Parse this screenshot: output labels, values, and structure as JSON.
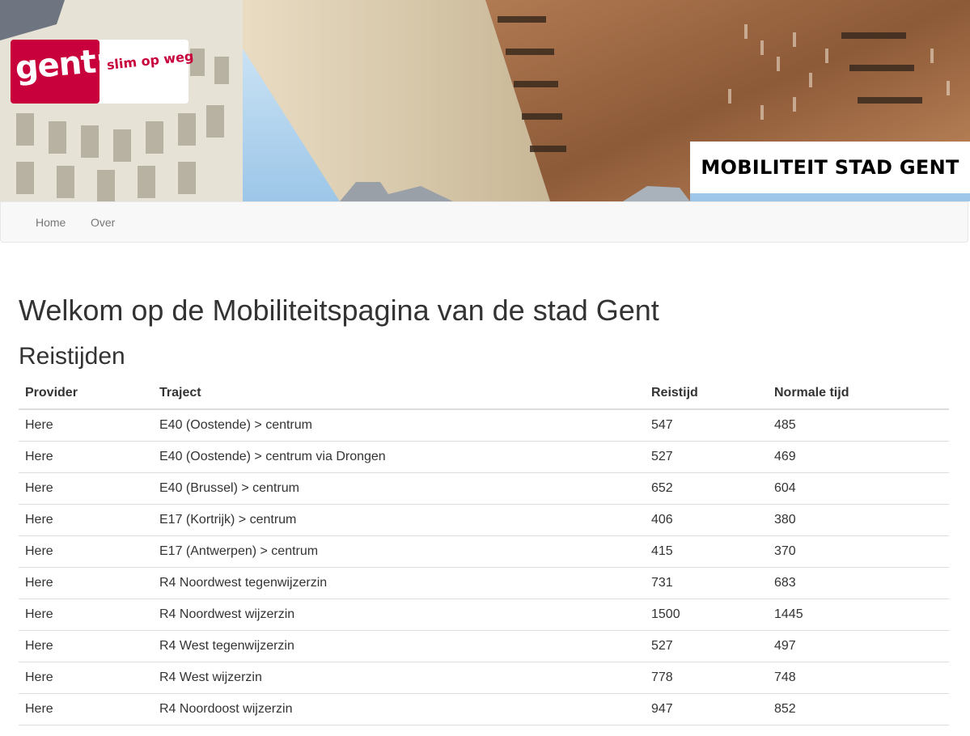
{
  "header": {
    "logo_word": "gent:",
    "logo_tagline": "slim op weg",
    "site_title": "MOBILITEIT STAD GENT"
  },
  "nav": {
    "items": [
      {
        "label": "Home"
      },
      {
        "label": "Over"
      }
    ]
  },
  "main": {
    "heading": "Welkom op de Mobiliteitspagina van de stad Gent",
    "subheading": "Reistijden",
    "table": {
      "columns": [
        "Provider",
        "Traject",
        "Reistijd",
        "Normale tijd"
      ],
      "rows": [
        [
          "Here",
          "E40 (Oostende) > centrum",
          "547",
          "485"
        ],
        [
          "Here",
          "E40 (Oostende) > centrum via Drongen",
          "527",
          "469"
        ],
        [
          "Here",
          "E40 (Brussel) > centrum",
          "652",
          "604"
        ],
        [
          "Here",
          "E17 (Kortrijk) > centrum",
          "406",
          "380"
        ],
        [
          "Here",
          "E17 (Antwerpen) > centrum",
          "415",
          "370"
        ],
        [
          "Here",
          "R4 Noordwest tegenwijzerzin",
          "731",
          "683"
        ],
        [
          "Here",
          "R4 Noordwest wijzerzin",
          "1500",
          "1445"
        ],
        [
          "Here",
          "R4 West tegenwijzerzin",
          "527",
          "497"
        ],
        [
          "Here",
          "R4 West wijzerzin",
          "778",
          "748"
        ],
        [
          "Here",
          "R4 Noordoost wijzerzin",
          "947",
          "852"
        ]
      ]
    }
  },
  "colors": {
    "brand_red": "#c8003c",
    "navbar_bg": "#f8f8f8",
    "nav_text": "#777777",
    "text": "#333333"
  }
}
